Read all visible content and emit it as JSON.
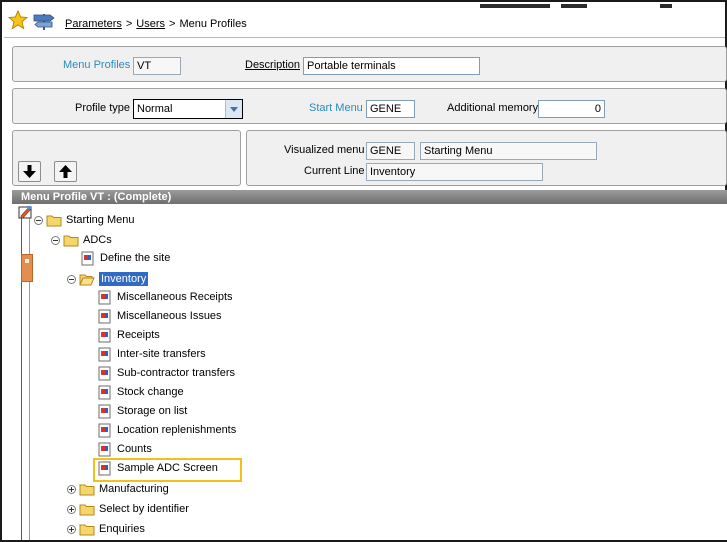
{
  "breadcrumb": {
    "parameters": "Parameters",
    "users": "Users",
    "current": "Menu Profiles",
    "separator": ">"
  },
  "header": {
    "menu_profiles_label": "Menu Profiles",
    "menu_profiles_value": "VT",
    "description_label": "Description",
    "description_value": "Portable terminals"
  },
  "profile": {
    "type_label": "Profile type",
    "type_value": "Normal",
    "start_menu_label": "Start Menu",
    "start_menu_value": "GENE",
    "additional_memory_label": "Additional memory",
    "additional_memory_value": "0"
  },
  "visualized": {
    "visualized_menu_label": "Visualized menu",
    "visualized_menu_code": "GENE",
    "visualized_menu_name": "Starting Menu",
    "current_line_label": "Current Line",
    "current_line_value": "Inventory"
  },
  "tree": {
    "header": "Menu Profile VT : (Complete)",
    "root": "Starting Menu",
    "adcs": "ADCs",
    "define_site": "Define the site",
    "inventory": "Inventory",
    "items": [
      "Miscellaneous Receipts",
      "Miscellaneous Issues",
      "Receipts",
      "Inter-site transfers",
      "Sub-contractor transfers",
      "Stock change",
      "Storage on list",
      "Location replenishments",
      "Counts",
      "Sample ADC Screen"
    ],
    "manufacturing": "Manufacturing",
    "select_by_identifier": "Select by identifier",
    "enquiries": "Enquiries"
  },
  "colors": {
    "accent_blue": "#2a8bbf",
    "selection": "#316ac5",
    "highlight": "#f2c01d",
    "header_bg": "#7a7a7a"
  },
  "icons": {
    "star": "favorites-star-icon",
    "signpost": "navigation-signpost-icon",
    "down": "arrow-down-icon",
    "up": "arrow-up-icon",
    "folder": "folder-icon",
    "doc": "function-doc-icon"
  }
}
